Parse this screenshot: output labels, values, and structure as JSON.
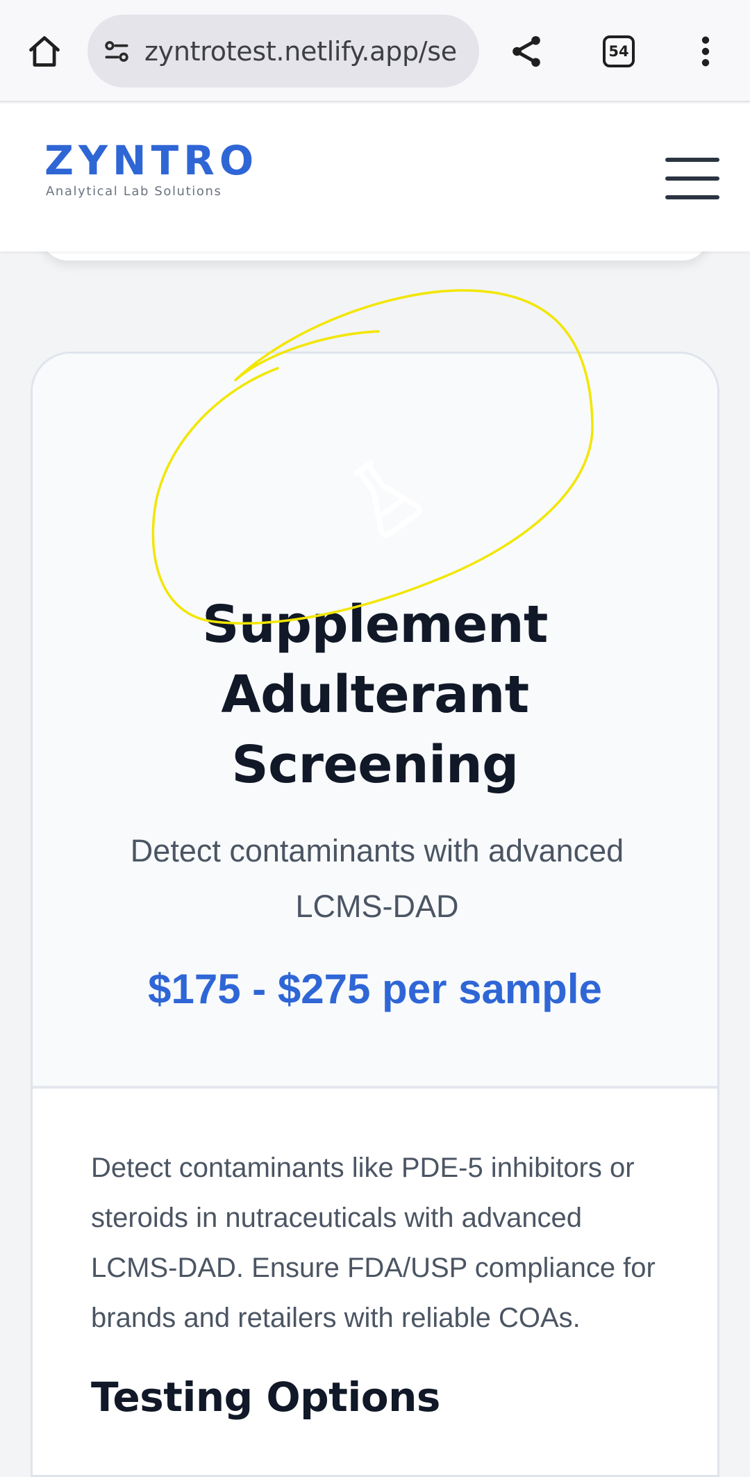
{
  "browser": {
    "url": "zyntrotest.netlify.app/se",
    "tab_count": "54"
  },
  "header": {
    "logo_name": "ZYNTRO",
    "logo_tagline": "Analytical Lab Solutions"
  },
  "card": {
    "title_lines": [
      "Supplement",
      "Adulterant",
      "Screening"
    ],
    "subtitle": "Detect contaminants with advanced LCMS-DAD",
    "price": "$175 - $275 per sample",
    "description": "Detect contaminants like PDE-5 inhibitors or steroids in nutraceuticals with advanced LCMS-DAD. Ensure FDA/USP compliance for brands and retailers with reliable COAs.",
    "section_heading": "Testing Options",
    "icon": "flask-icon"
  },
  "colors": {
    "brand_blue": "#2f66d6",
    "annotation_yellow": "#f2e600"
  }
}
